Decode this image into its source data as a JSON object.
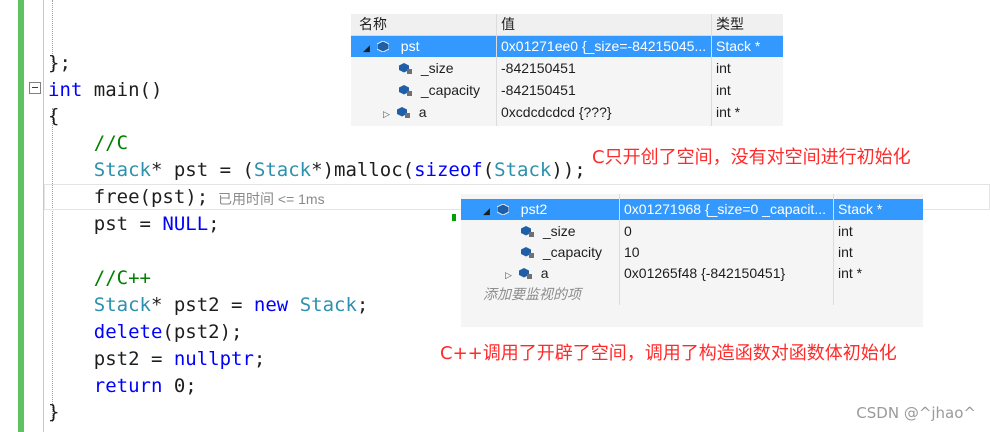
{
  "code_lines": [
    {
      "id": "l1",
      "tokens": [
        {
          "t": "};",
          "c": "pl"
        }
      ]
    },
    {
      "id": "l2",
      "tokens": [
        {
          "t": "int",
          "c": "kw"
        },
        {
          "t": " main()",
          "c": "pl"
        }
      ]
    },
    {
      "id": "l3",
      "tokens": [
        {
          "t": "{",
          "c": "pl"
        }
      ]
    },
    {
      "id": "l4",
      "tokens": [
        {
          "t": "    //C",
          "c": "cm"
        }
      ]
    },
    {
      "id": "l5",
      "tokens": [
        {
          "t": "    ",
          "c": "pl"
        },
        {
          "t": "Stack",
          "c": "ty"
        },
        {
          "t": "* pst = (",
          "c": "pl"
        },
        {
          "t": "Stack",
          "c": "ty"
        },
        {
          "t": "*)malloc(",
          "c": "pl"
        },
        {
          "t": "sizeof",
          "c": "kw"
        },
        {
          "t": "(",
          "c": "pl"
        },
        {
          "t": "Stack",
          "c": "ty"
        },
        {
          "t": "));",
          "c": "pl"
        }
      ]
    },
    {
      "id": "l6",
      "tokens": [
        {
          "t": "    free(pst);",
          "c": "pl"
        }
      ]
    },
    {
      "id": "l7",
      "tokens": [
        {
          "t": "    pst = ",
          "c": "pl"
        },
        {
          "t": "NULL",
          "c": "kw"
        },
        {
          "t": ";",
          "c": "pl"
        }
      ]
    },
    {
      "id": "l8",
      "tokens": [
        {
          "t": "",
          "c": "pl"
        }
      ]
    },
    {
      "id": "l9",
      "tokens": [
        {
          "t": "    //C++",
          "c": "cm"
        }
      ]
    },
    {
      "id": "l10",
      "tokens": [
        {
          "t": "    ",
          "c": "pl"
        },
        {
          "t": "Stack",
          "c": "ty"
        },
        {
          "t": "* pst2 = ",
          "c": "pl"
        },
        {
          "t": "new",
          "c": "kw"
        },
        {
          "t": " ",
          "c": "pl"
        },
        {
          "t": "Stack",
          "c": "ty"
        },
        {
          "t": ";",
          "c": "pl"
        }
      ]
    },
    {
      "id": "l11",
      "tokens": [
        {
          "t": "    ",
          "c": "pl"
        },
        {
          "t": "delete",
          "c": "kw"
        },
        {
          "t": "(pst2);",
          "c": "pl"
        }
      ]
    },
    {
      "id": "l12",
      "tokens": [
        {
          "t": "    pst2 = ",
          "c": "pl"
        },
        {
          "t": "nullptr",
          "c": "kw"
        },
        {
          "t": ";",
          "c": "pl"
        }
      ]
    },
    {
      "id": "l13",
      "tokens": [
        {
          "t": "    ",
          "c": "pl"
        },
        {
          "t": "return",
          "c": "kw"
        },
        {
          "t": " 0;",
          "c": "pl"
        }
      ]
    },
    {
      "id": "l14",
      "tokens": [
        {
          "t": "}",
          "c": "pl"
        }
      ]
    }
  ],
  "perf_hint": "已用时间 <= 1ms",
  "watch1": {
    "headers": {
      "name": "名称",
      "value": "值",
      "type": "类型"
    },
    "rows": [
      {
        "name": "pst",
        "value": "0x01271ee0 {_size=-84215045...",
        "type": "Stack *"
      },
      {
        "name": "_size",
        "value": "-842150451",
        "type": "int"
      },
      {
        "name": "_capacity",
        "value": "-842150451",
        "type": "int"
      },
      {
        "name": "a",
        "value": "0xcdcdcdcd {???}",
        "type": "int *"
      }
    ]
  },
  "watch2": {
    "rows": [
      {
        "name": "pst2",
        "value": "0x01271968 {_size=0 _capacit...",
        "type": "Stack *"
      },
      {
        "name": "_size",
        "value": "0",
        "type": "int"
      },
      {
        "name": "_capacity",
        "value": "10",
        "type": "int"
      },
      {
        "name": "a",
        "value": "0x01265f48 {-842150451}",
        "type": "int *"
      }
    ],
    "add_watch": "添加要监视的项"
  },
  "annotations": {
    "c_note": "C只开创了空间，没有对空间进行初始化",
    "cpp_note": "C++调用了开辟了空间，调用了构造函数对函数体初始化"
  },
  "watermark": "CSDN @^jhao^",
  "colors": {
    "keyword": "#0000ff",
    "type": "#2b91af",
    "comment": "#008000",
    "annotation": "#ff2a2a",
    "selection": "#3399ff"
  }
}
